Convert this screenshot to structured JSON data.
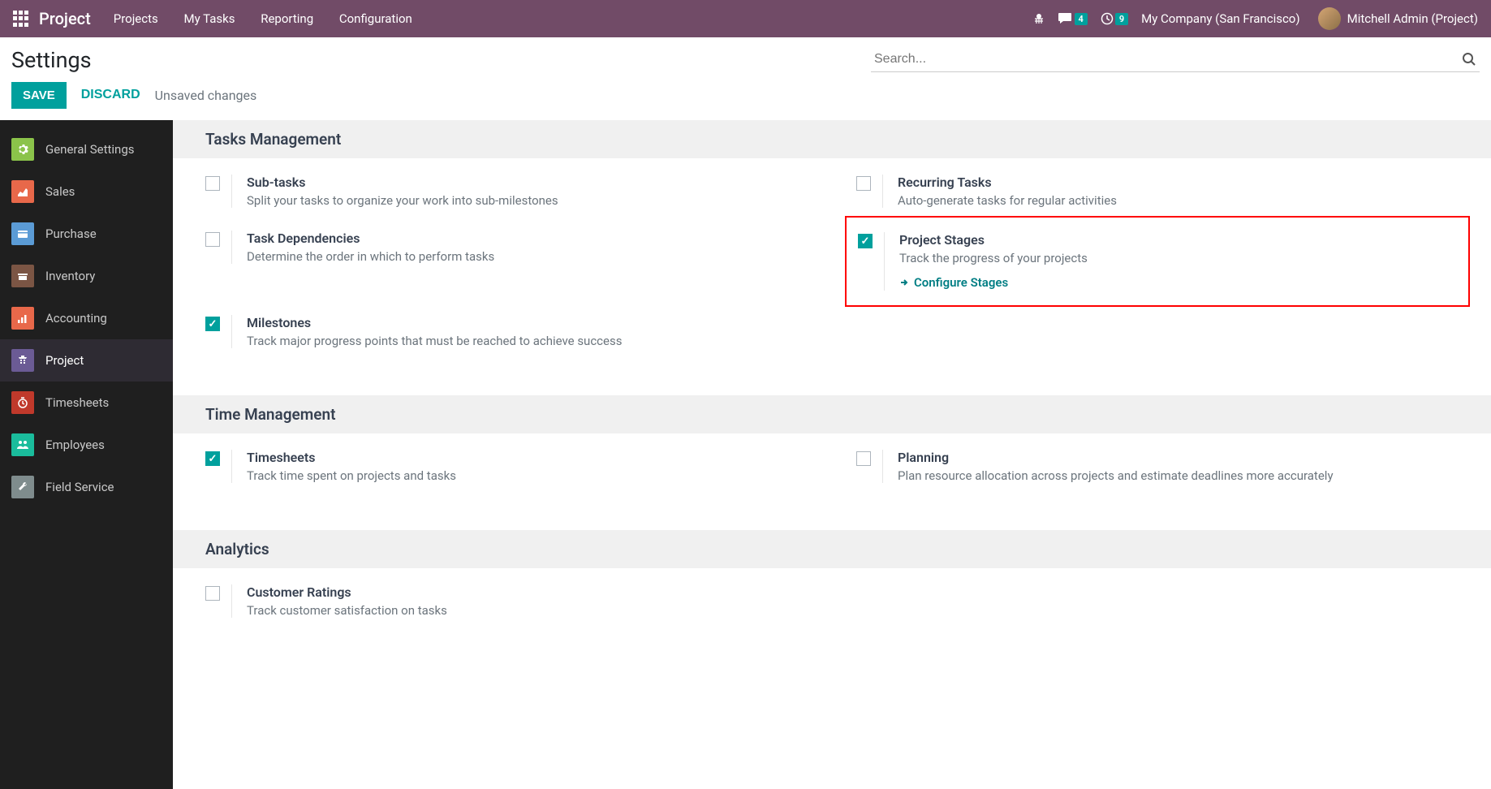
{
  "nav": {
    "brand": "Project",
    "menu": [
      "Projects",
      "My Tasks",
      "Reporting",
      "Configuration"
    ],
    "messages_count": "4",
    "activities_count": "9",
    "company": "My Company (San Francisco)",
    "user": "Mitchell Admin (Project)"
  },
  "page": {
    "title": "Settings",
    "search_placeholder": "Search...",
    "save": "SAVE",
    "discard": "DISCARD",
    "unsaved": "Unsaved changes"
  },
  "sidebar": [
    {
      "label": "General Settings",
      "color": "#8BC34A"
    },
    {
      "label": "Sales",
      "color": "#E8684A"
    },
    {
      "label": "Purchase",
      "color": "#5B9BD5"
    },
    {
      "label": "Inventory",
      "color": "#7B5544"
    },
    {
      "label": "Accounting",
      "color": "#E8684A"
    },
    {
      "label": "Project",
      "color": "#6B5B95",
      "active": true
    },
    {
      "label": "Timesheets",
      "color": "#C0392B"
    },
    {
      "label": "Employees",
      "color": "#1ABC9C"
    },
    {
      "label": "Field Service",
      "color": "#7F8C8D"
    }
  ],
  "sections": [
    {
      "title": "Tasks Management",
      "rows": [
        {
          "left": {
            "title": "Sub-tasks",
            "desc": "Split your tasks to organize your work into sub-milestones",
            "checked": false
          },
          "right": {
            "title": "Recurring Tasks",
            "desc": "Auto-generate tasks for regular activities",
            "checked": false
          }
        },
        {
          "left": {
            "title": "Task Dependencies",
            "desc": "Determine the order in which to perform tasks",
            "checked": false
          },
          "right": {
            "title": "Project Stages",
            "desc": "Track the progress of your projects",
            "checked": true,
            "highlighted": true,
            "action": "Configure Stages"
          }
        },
        {
          "left": {
            "title": "Milestones",
            "desc": "Track major progress points that must be reached to achieve success",
            "checked": true
          }
        }
      ]
    },
    {
      "title": "Time Management",
      "rows": [
        {
          "left": {
            "title": "Timesheets",
            "desc": "Track time spent on projects and tasks",
            "checked": true
          },
          "right": {
            "title": "Planning",
            "desc": "Plan resource allocation across projects and estimate deadlines more accurately",
            "checked": false
          }
        }
      ]
    },
    {
      "title": "Analytics",
      "rows": [
        {
          "left": {
            "title": "Customer Ratings",
            "desc": "Track customer satisfaction on tasks",
            "checked": false
          }
        }
      ]
    }
  ]
}
